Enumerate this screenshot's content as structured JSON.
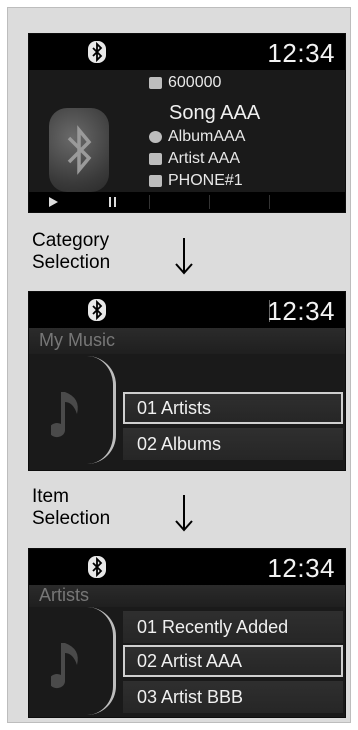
{
  "screens": {
    "now_playing": {
      "time": "12:34",
      "track_number": "600000",
      "song": "Song AAA",
      "album": "AlbumAAA",
      "artist": "Artist AAA",
      "device": "PHONE#1",
      "icons": [
        "bluetooth-icon",
        "play-icon",
        "pause-icon",
        "track-icon",
        "album-icon",
        "artist-icon",
        "phone-icon"
      ]
    },
    "category": {
      "time": "12:34",
      "title": "My Music",
      "items": [
        "01 Artists",
        "02 Albums"
      ],
      "selected_index": 0
    },
    "item": {
      "time": "12:34",
      "title": "Artists",
      "items": [
        "01 Recently Added",
        "02 Artist AAA",
        "03 Artist BBB"
      ],
      "selected_index": 1
    }
  },
  "steps": {
    "category_label_line1": "Category",
    "category_label_line2": "Selection",
    "item_label_line1": "Item",
    "item_label_line2": "Selection"
  },
  "colors": {
    "screen_bg": "#1a1a1a",
    "text": "#f0f0f0",
    "dim_title": "#777777",
    "panel": "#dcdcdc"
  }
}
